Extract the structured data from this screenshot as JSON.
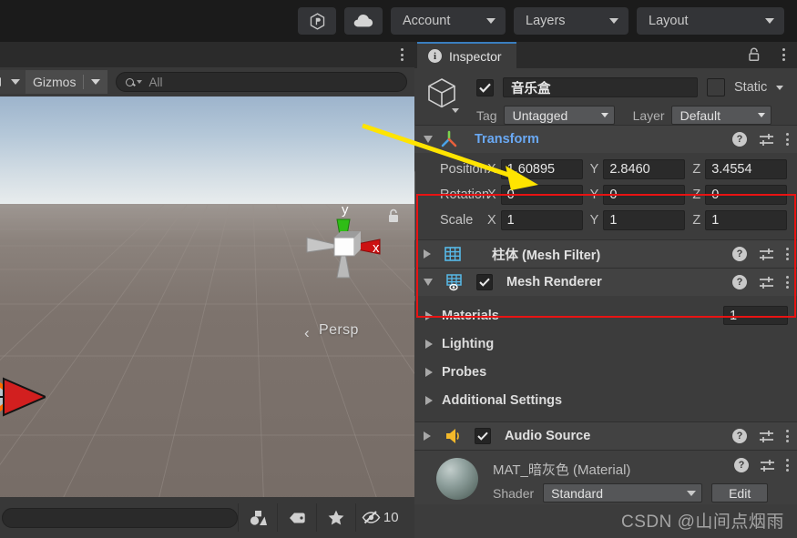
{
  "top_toolbar": {
    "buttons": [
      {
        "name": "unity-services-icon",
        "label": ""
      },
      {
        "name": "cloud-icon",
        "label": ""
      }
    ],
    "account_label": "Account",
    "layers_label": "Layers",
    "layout_label": "Layout"
  },
  "scene_panel": {
    "gizmos_label": "Gizmos",
    "search_placeholder": "All",
    "viewport": {
      "axis_y_label": "y",
      "axis_x_label": "x",
      "perspective_label": "Persp",
      "perspective_arrow": "‹"
    }
  },
  "bottom_bar": {
    "search_value": "",
    "hidden_count": "10",
    "icons": [
      "shapes-icon",
      "tag-icon",
      "star-icon",
      "hidden-eye-icon"
    ]
  },
  "inspector": {
    "tab_label": "Inspector",
    "gameobject": {
      "enabled": true,
      "name": "音乐盒",
      "static_label": "Static",
      "static_checked": false,
      "tag_label": "Tag",
      "tag_value": "Untagged",
      "layer_label": "Layer",
      "layer_value": "Default"
    },
    "transform": {
      "title": "Transform",
      "rows": [
        {
          "label": "Position",
          "x": "1.60895",
          "y": "2.8460",
          "z": "3.4554"
        },
        {
          "label": "Rotation",
          "x": "0",
          "y": "0",
          "z": "0"
        },
        {
          "label": "Scale",
          "x": "1",
          "y": "1",
          "z": "1"
        }
      ],
      "axis_labels": [
        "X",
        "Y",
        "Z"
      ]
    },
    "components": [
      {
        "title": "柱体 (Mesh Filter)",
        "has_checkbox": false,
        "expanded": false,
        "icon": "mesh-filter-icon"
      },
      {
        "title": "Mesh Renderer",
        "has_checkbox": true,
        "checked": true,
        "expanded": true,
        "icon": "mesh-renderer-icon"
      }
    ],
    "mesh_renderer_sections": [
      {
        "label": "Materials",
        "value": "1"
      },
      {
        "label": "Lighting",
        "value": ""
      },
      {
        "label": "Probes",
        "value": ""
      },
      {
        "label": "Additional Settings",
        "value": ""
      }
    ],
    "audio_source": {
      "title": "Audio Source",
      "checked": true,
      "icon": "audio-source-icon"
    },
    "material_preview": {
      "title": "MAT_暗灰色 (Material)",
      "shader_label": "Shader",
      "shader_value": "Standard",
      "edit_label": "Edit"
    }
  },
  "annotations": {
    "watermark": "CSDN @山间点烟雨",
    "highlight_color": "#e81313",
    "arrow_color": "#ffe400"
  }
}
